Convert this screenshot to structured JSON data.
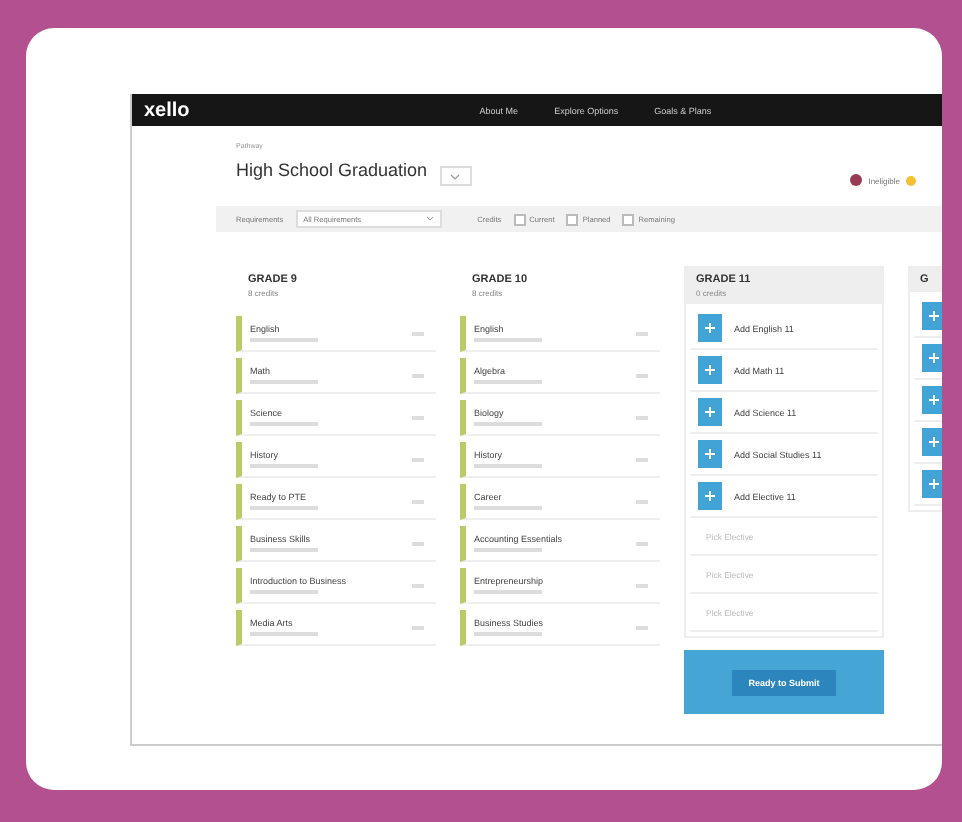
{
  "nav": {
    "logo": "xello",
    "items": [
      "About Me",
      "Explore Options",
      "Goals & Plans"
    ]
  },
  "plan": {
    "label": "Pathway",
    "title": "High School Graduation",
    "status": "Ineligible"
  },
  "filters": {
    "label": "Requirements",
    "select": "All Requirements",
    "credits_label": "Credits",
    "options": [
      {
        "label": "Current",
        "checked": false
      },
      {
        "label": "Planned",
        "checked": false
      },
      {
        "label": "Remaining",
        "checked": false
      }
    ]
  },
  "grades": [
    {
      "kind": "planned",
      "title": "GRADE 9",
      "subtitle": "8 credits",
      "courses": [
        "English",
        "Math",
        "Science",
        "History",
        "Ready to PTE",
        "Business Skills",
        "Introduction to Business",
        "Media Arts"
      ]
    },
    {
      "kind": "planned",
      "title": "GRADE 10",
      "subtitle": "8 credits",
      "courses": [
        "English",
        "Algebra",
        "Biology",
        "History",
        "Career",
        "Accounting Essentials",
        "Entrepreneurship",
        "Business Studies"
      ]
    },
    {
      "kind": "open",
      "title": "GRADE 11",
      "subtitle": "0 credits",
      "courses": [
        {
          "kind": "add",
          "label": "Add English 11"
        },
        {
          "kind": "add",
          "label": "Add Math 11"
        },
        {
          "kind": "add",
          "label": "Add Science 11"
        },
        {
          "kind": "add",
          "label": "Add Social Studies 11"
        },
        {
          "kind": "add",
          "label": "Add Elective 11"
        }
      ],
      "slots": [
        "Pick Elective",
        "Pick Elective",
        "Pick Elective"
      ],
      "action": "Ready to Submit"
    },
    {
      "kind": "open",
      "title": "G",
      "courses": [
        {
          "kind": "add"
        },
        {
          "kind": "add"
        },
        {
          "kind": "add"
        },
        {
          "kind": "add"
        },
        {
          "kind": "add"
        }
      ]
    }
  ]
}
